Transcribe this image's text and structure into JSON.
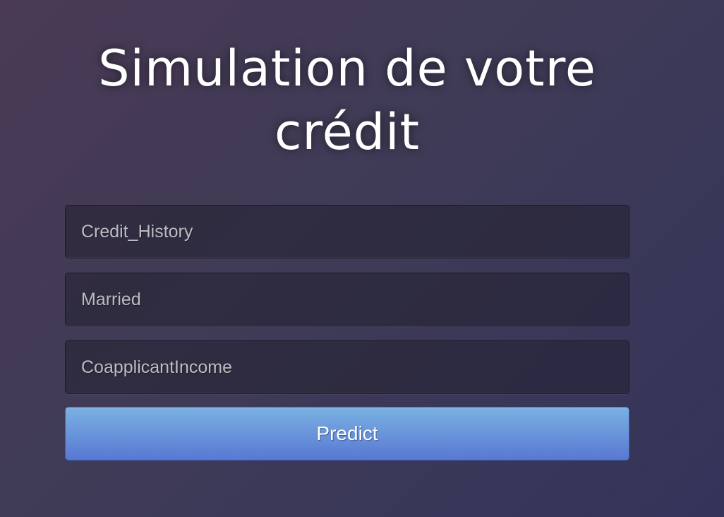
{
  "page": {
    "title": "Simulation de votre crédit"
  },
  "form": {
    "fields": [
      {
        "placeholder": "Credit_History",
        "value": ""
      },
      {
        "placeholder": "Married",
        "value": ""
      },
      {
        "placeholder": "CoapplicantIncome",
        "value": ""
      }
    ],
    "submit_label": "Predict"
  },
  "colors": {
    "button_gradient_top": "#7ab1e2",
    "button_gradient_bottom": "#5878d3",
    "background": "#3f3b57"
  }
}
